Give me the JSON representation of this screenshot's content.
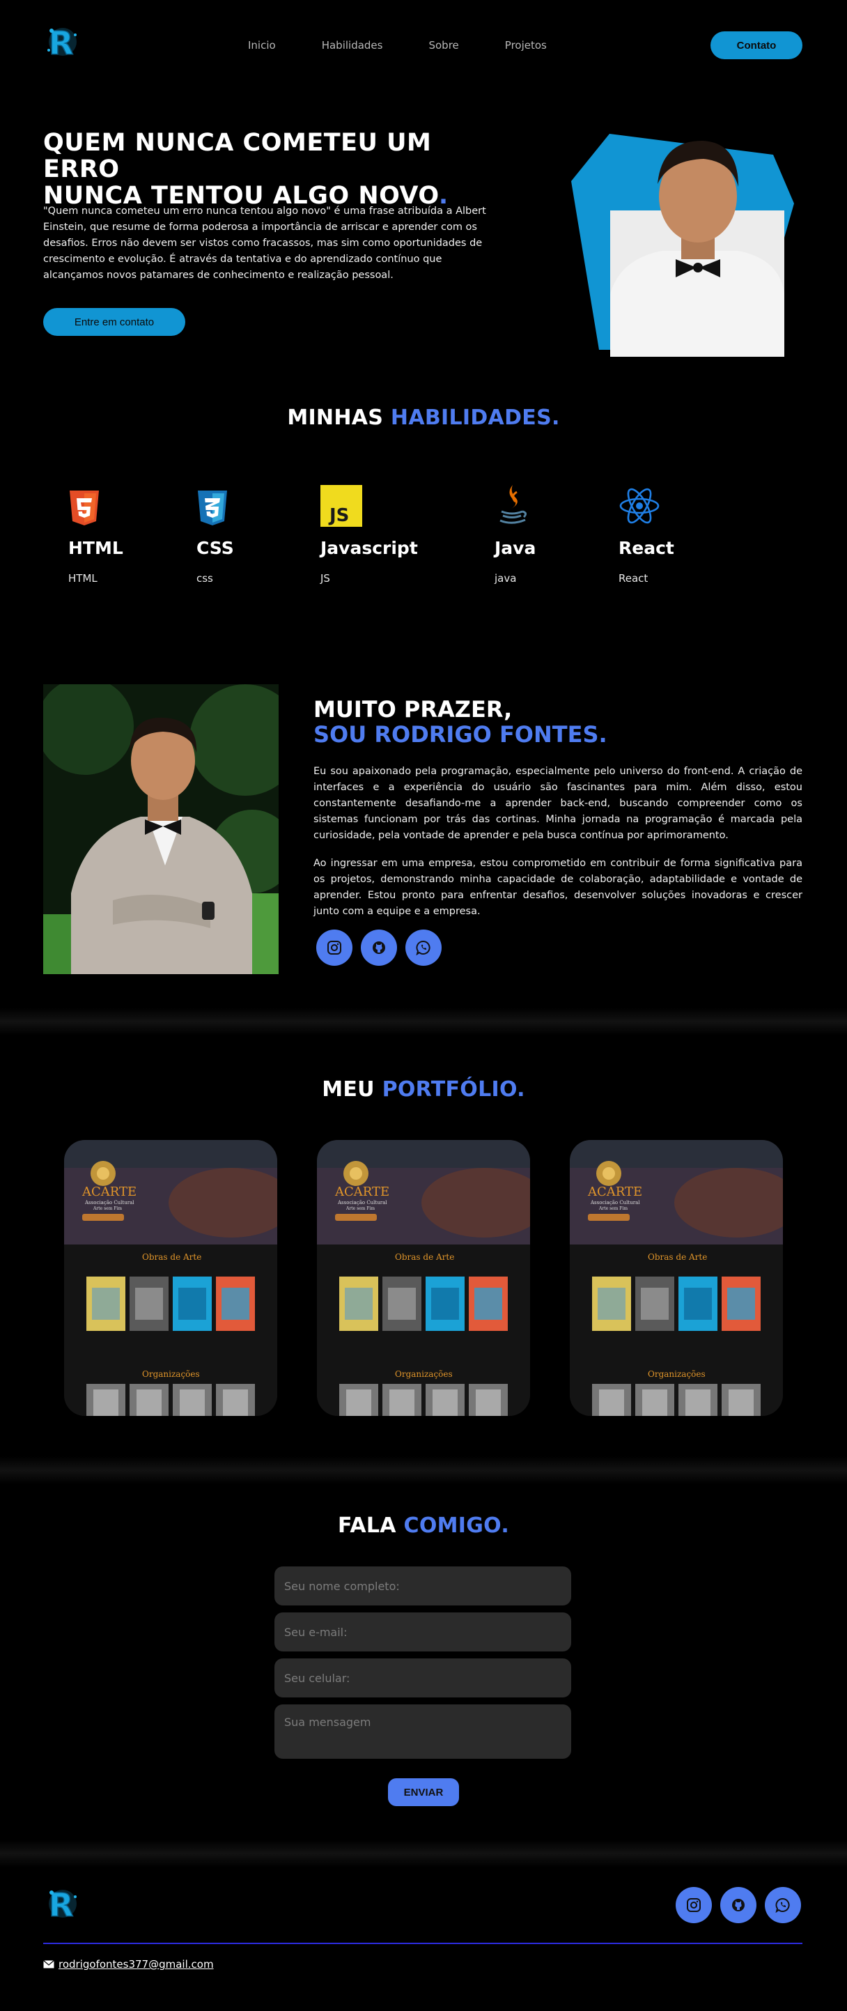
{
  "nav": {
    "links": [
      "Inicio",
      "Habilidades",
      "Sobre",
      "Projetos"
    ],
    "cta": "Contato"
  },
  "hero": {
    "title_line1": "QUEM NUNCA COMETEU UM ERRO",
    "title_line2": "NUNCA TENTOU ALGO NOVO",
    "title_dot": ".",
    "text": "\"Quem nunca cometeu um erro nunca tentou algo novo\" é uma frase atribuída a Albert Einstein, que resume de forma poderosa a importância de arriscar e aprender com os desafios. Erros não devem ser vistos como fracassos, mas sim como oportunidades de crescimento e evolução. É através da tentativa e do aprendizado contínuo que alcançamos novos patamares de conhecimento e realização pessoal.",
    "button": "Entre em contato"
  },
  "skills": {
    "title_white": "MINHAS ",
    "title_accent": "HABILIDADES.",
    "items": [
      {
        "name": "HTML",
        "desc": "HTML",
        "icon": "html5-icon"
      },
      {
        "name": "CSS",
        "desc": "css",
        "icon": "css3-icon"
      },
      {
        "name": "Javascript",
        "desc": "JS",
        "icon": "javascript-icon"
      },
      {
        "name": "Java",
        "desc": "java",
        "icon": "java-icon"
      },
      {
        "name": "React",
        "desc": "React",
        "icon": "react-icon"
      }
    ]
  },
  "about": {
    "title_line1": "MUITO PRAZER,",
    "title_line2": "SOU RODRIGO FONTES.",
    "p1": "Eu sou apaixonado pela programação, especialmente pelo universo do front-end. A criação de interfaces e a experiência do usuário são fascinantes para mim. Além disso, estou constantemente desafiando-me a aprender back-end, buscando compreender como os sistemas funcionam por trás das cortinas. Minha jornada na programação é marcada pela curiosidade, pela vontade de aprender e pela busca contínua por aprimoramento.",
    "p2": "Ao ingressar em uma empresa, estou comprometido em contribuir de forma significativa para os projetos, demonstrando minha capacidade de colaboração, adaptabilidade e vontade de aprender. Estou pronto para enfrentar desafios, desenvolver soluções inovadoras e crescer junto com a equipe e a empresa."
  },
  "portfolio": {
    "title_white": "MEU ",
    "title_accent": "PORTFÓLIO.",
    "card": {
      "brand": "ACARTE",
      "subtitle": "Associação Cultural",
      "tagline": "Arte sem Fim",
      "section1": "Obras de Arte",
      "section2": "Organizações"
    }
  },
  "contact": {
    "title_white": "FALA ",
    "title_accent": "COMIGO.",
    "name_placeholder": "Seu nome completo:",
    "email_placeholder": "Seu e-mail:",
    "phone_placeholder": "Seu celular:",
    "message_placeholder": "Sua mensagem",
    "submit": "ENVIAR"
  },
  "footer": {
    "email": "rodrigofontes377@gmail.com"
  },
  "colors": {
    "accent": "#4f7cf0",
    "cyan": "#1195d3",
    "background": "#000000"
  }
}
